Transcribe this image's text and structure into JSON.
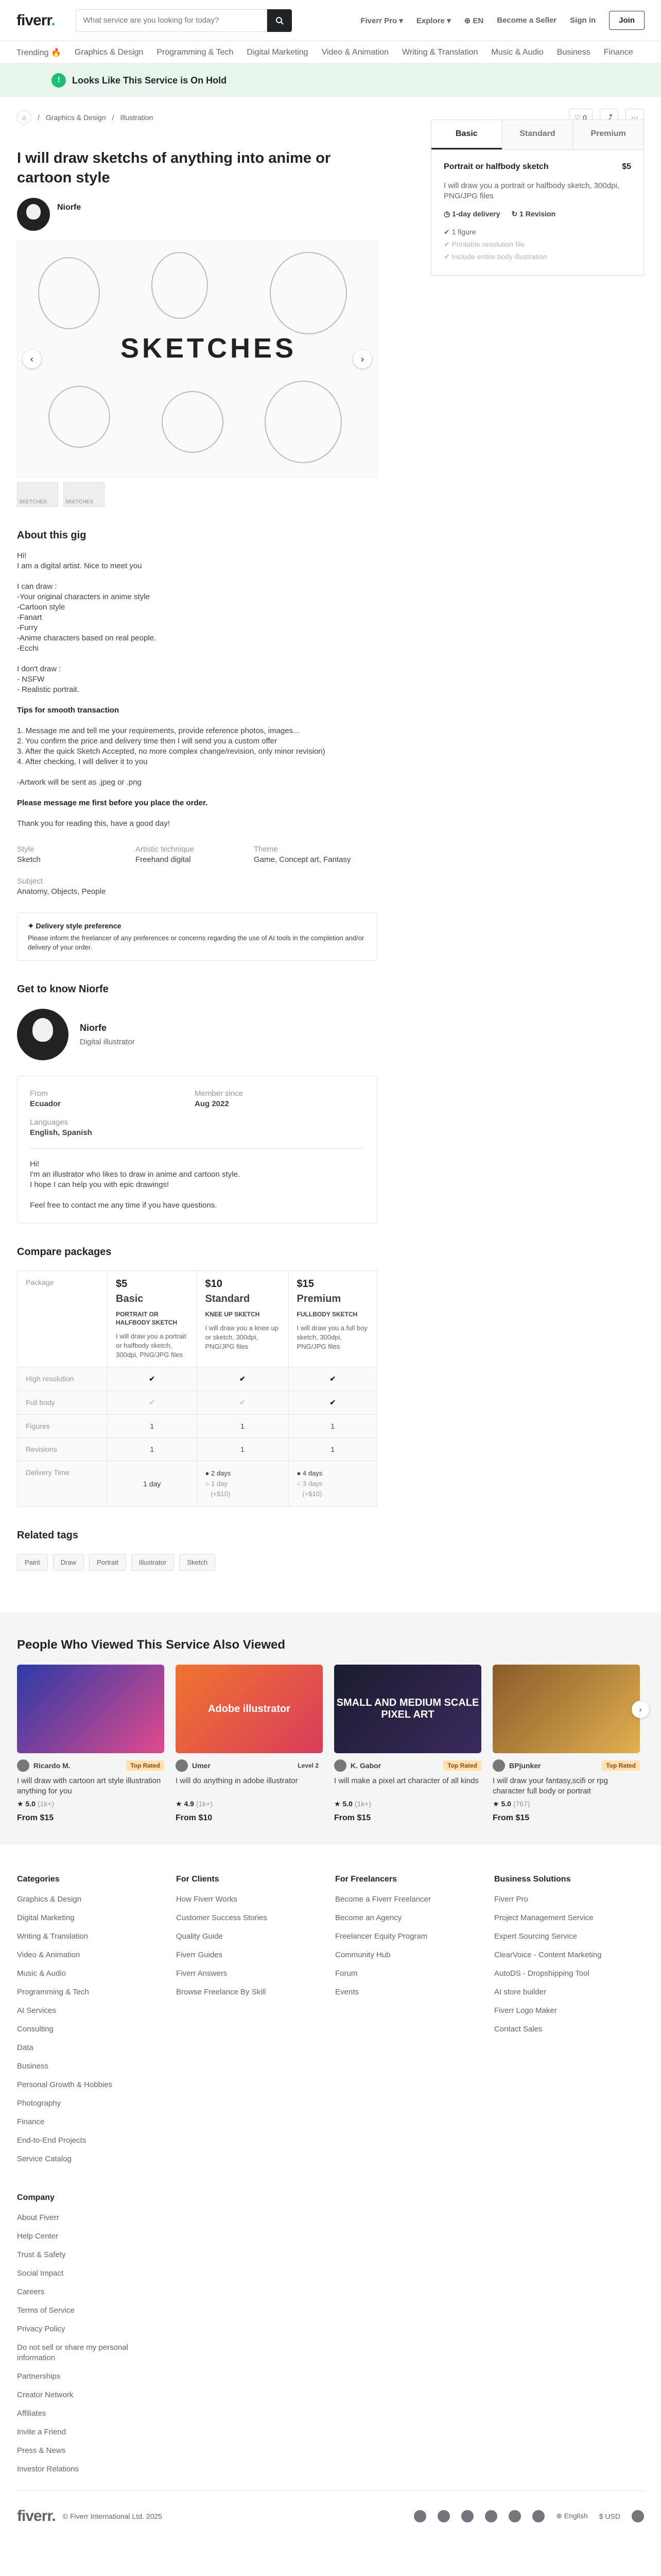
{
  "header": {
    "logo": "fiverr",
    "search_placeholder": "What service are you looking for today?",
    "nav": [
      "Fiverr Pro",
      "Explore",
      "EN",
      "Become a Seller",
      "Sign in"
    ],
    "join": "Join"
  },
  "categories": [
    "Trending 🔥",
    "Graphics & Design",
    "Programming & Tech",
    "Digital Marketing",
    "Video & Animation",
    "Writing & Translation",
    "Music & Audio",
    "Business",
    "Finance"
  ],
  "banner": "Looks Like This Service is On Hold",
  "breadcrumb": [
    "Graphics & Design",
    "Illustration"
  ],
  "toolbar": {
    "likes": "0"
  },
  "gig": {
    "title": "I will draw sketchs of anything into anime or cartoon style",
    "seller": "Niorfe",
    "hero_text": "SKETCHES",
    "thumb_label": "SKETCHES"
  },
  "about": {
    "heading": "About this gig",
    "paras": [
      "Hi!\nI am a digital artist. Nice to meet you",
      "I can draw :\n-Your original characters in anime style\n-Cartoon style\n-Fanart\n-Furry\n-Anime characters based on real people.\n-Ecchi",
      "I don't draw :\n- NSFW\n- Realistic portrait."
    ],
    "tips_title": "Tips for smooth transaction",
    "tips": "1. Message me and tell me your requirements, provide reference photos, images...\n2. You confirm the price and delivery time then I will send you a custom offer\n3. After the quick Sketch Accepted, no more complex change/revision, only minor revision)\n4. After checking, I will deliver it to you",
    "artwork": "-Artwork will be sent as .jpeg or .png",
    "msg": "Please message me first before you place the order.",
    "thanks": "Thank you for reading this, have a good day!"
  },
  "meta": [
    {
      "k": "Style",
      "v": "Sketch"
    },
    {
      "k": "Artistic technique",
      "v": "Freehand digital"
    },
    {
      "k": "Theme",
      "v": "Game, Concept art, Fantasy"
    },
    {
      "k": "Subject",
      "v": "Anatomy, Objects, People"
    }
  ],
  "notice": {
    "title": "Delivery style preference",
    "text": "Please inform the freelancer of any preferences or concerns regarding the use of AI tools in the completion and/or delivery of your order."
  },
  "know": {
    "heading": "Get to know Niorfe",
    "name": "Niorfe",
    "role": "Digital illustrator",
    "from_k": "From",
    "from_v": "Ecuador",
    "since_k": "Member since",
    "since_v": "Aug 2022",
    "lang_k": "Languages",
    "lang_v": "English, Spanish",
    "bio": "Hi!\nI'm an illustrator who likes to draw in anime and cartoon style.\nI hope I can help you with epic drawings!",
    "bio2": "Feel free to contact me any time if you have questions."
  },
  "compare": {
    "heading": "Compare packages",
    "package_label": "Package",
    "packages": [
      {
        "price": "$5",
        "name": "Basic",
        "title": "PORTRAIT OR HALFBODY SKETCH",
        "desc": "I will draw you a portrait or halfbody sketch, 300dpi, PNG/JPG files",
        "days": "1 day"
      },
      {
        "price": "$10",
        "name": "Standard",
        "title": "KNEE UP SKETCH",
        "desc": "I will draw you a knee up or sketch, 300dpi, PNG/JPG files",
        "days": "2 days",
        "alt": "1 day",
        "altprice": "(+$10)"
      },
      {
        "price": "$15",
        "name": "Premium",
        "title": "FULLBODY SKETCH",
        "desc": "I will draw you a full boy sketch, 300dpi, PNG/JPG files",
        "days": "4 days",
        "alt": "3 days",
        "altprice": "(+$10)"
      }
    ],
    "rows": [
      "High resolution",
      "Full body",
      "Figures",
      "Revisions",
      "Delivery Time"
    ],
    "figures": [
      "1",
      "1",
      "1"
    ],
    "revisions": [
      "1",
      "1",
      "1"
    ]
  },
  "tags_heading": "Related tags",
  "tags": [
    "Paint",
    "Draw",
    "Portrait",
    "Illustrator",
    "Sketch"
  ],
  "panel": {
    "tabs": [
      "Basic",
      "Standard",
      "Premium"
    ],
    "title": "Portrait or halfbody sketch",
    "price": "$5",
    "desc": "I will draw you a portrait or halfbody sketch, 300dpi, PNG/JPG files",
    "delivery": "1-day delivery",
    "revisions": "1 Revision",
    "features": [
      "1 figure",
      "Printable resolution file",
      "Include entire body illustration"
    ]
  },
  "viewed": {
    "heading": "People Who Viewed This Service Also Viewed",
    "cards": [
      {
        "seller": "Ricardo M.",
        "level": "Top Rated",
        "title": "I will draw with cartoon art style illustration anything for you",
        "rating": "5.0",
        "count": "(1k+)",
        "from": "From $15",
        "img": "",
        "c1": "#2a3aa8",
        "c2": "#e04a8c"
      },
      {
        "seller": "Umer",
        "level": "Level 2",
        "title": "I will do anything in adobe illustrator",
        "rating": "4.9",
        "count": "(1k+)",
        "from": "From $10",
        "img": "Adobe illustrator",
        "c1": "#f0742e",
        "c2": "#d93c5c"
      },
      {
        "seller": "K. Gabor",
        "level": "Top Rated",
        "title": "I will make a pixel art character of all kinds",
        "rating": "5.0",
        "count": "(1k+)",
        "from": "From $15",
        "img": "SMALL AND MEDIUM SCALE PIXEL ART",
        "c1": "#1b1b2e",
        "c2": "#3a2a5e"
      },
      {
        "seller": "BPjunker",
        "level": "Top Rated",
        "title": "I will draw your fantasy,scifi or rpg character full body or portrait",
        "rating": "5.0",
        "count": "(767)",
        "from": "From $15",
        "img": "",
        "c1": "#8a5a2a",
        "c2": "#e0b050"
      }
    ]
  },
  "footer": {
    "cols": [
      {
        "h": "Categories",
        "links": [
          "Graphics & Design",
          "Digital Marketing",
          "Writing & Translation",
          "Video & Animation",
          "Music & Audio",
          "Programming & Tech",
          "AI Services",
          "Consulting",
          "Data",
          "Business",
          "Personal Growth & Hobbies",
          "Photography",
          "Finance",
          "End-to-End Projects",
          "Service Catalog"
        ]
      },
      {
        "h": "For Clients",
        "links": [
          "How Fiverr Works",
          "Customer Success Stories",
          "Quality Guide",
          "Fiverr Guides",
          "Fiverr Answers",
          "Browse Freelance By Skill"
        ]
      },
      {
        "h": "For Freelancers",
        "links": [
          "Become a Fiverr Freelancer",
          "Become an Agency",
          "Freelancer Equity Program",
          "Community Hub",
          "Forum",
          "Events"
        ]
      },
      {
        "h": "Business Solutions",
        "links": [
          "Fiverr Pro",
          "Project Management Service",
          "Expert Sourcing Service",
          "ClearVoice - Content Marketing",
          "AutoDS - Dropshipping Tool",
          "AI store builder",
          "Fiverr Logo Maker",
          "Contact Sales"
        ]
      }
    ],
    "company": {
      "h": "Company",
      "links": [
        "About Fiverr",
        "Help Center",
        "Trust & Safety",
        "Social Impact",
        "Careers",
        "Terms of Service",
        "Privacy Policy",
        "Do not sell or share my personal information",
        "Partnerships",
        "Creator Network",
        "Affiliates",
        "Invite a Friend",
        "Press & News",
        "Investor Relations"
      ]
    },
    "copyright": "© Fiverr International Ltd. 2025",
    "lang": "English",
    "currency": "$ USD"
  }
}
